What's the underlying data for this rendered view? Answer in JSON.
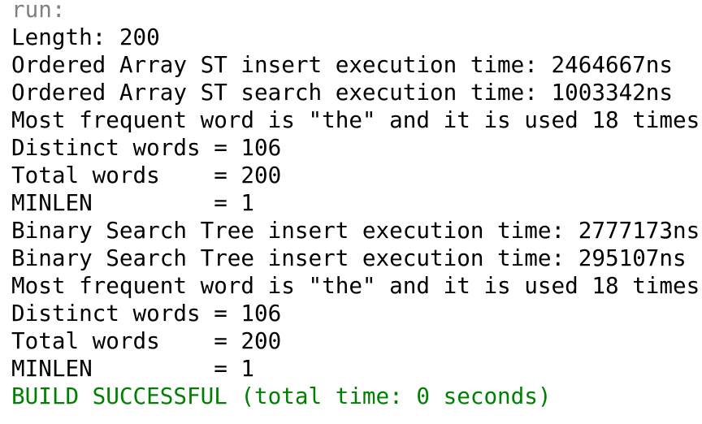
{
  "console": {
    "colors": {
      "text": "#000000",
      "header": "#808080",
      "success": "#008000"
    },
    "lines": [
      "run:",
      "Length: 200",
      "Ordered Array ST insert execution time: 2464667ns",
      "Ordered Array ST search execution time: 1003342ns",
      "Most frequent word is \"the\" and it is used 18 times",
      "Distinct words = 106",
      "Total words    = 200",
      "MINLEN         = 1",
      "Binary Search Tree insert execution time: 2777173ns",
      "Binary Search Tree insert execution time: 295107ns",
      "Most frequent word is \"the\" and it is used 18 times",
      "Distinct words = 106",
      "Total words    = 200",
      "MINLEN         = 1",
      "BUILD SUCCESSFUL (total time: 0 seconds)"
    ]
  }
}
